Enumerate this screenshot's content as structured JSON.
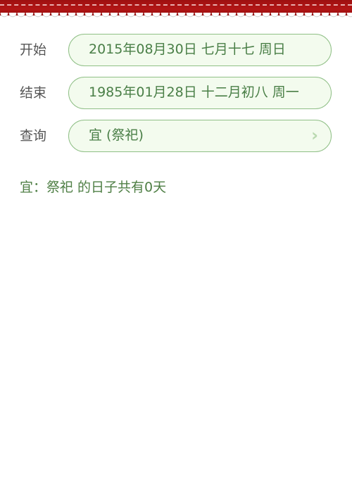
{
  "form": {
    "start": {
      "label": "开始",
      "value": "2015年08月30日 七月十七 周日"
    },
    "end": {
      "label": "结束",
      "value": "1985年01月28日 十二月初八 周一"
    },
    "query": {
      "label": "查询",
      "value": "宜 (祭祀)",
      "icon": "chevron-right-icon"
    }
  },
  "result": {
    "text": "宜：祭祀 的日子共有0天"
  },
  "colors": {
    "accent_text": "#4a7f47",
    "field_border": "#8fbf86",
    "field_bg": "#f3fbee",
    "label_text": "#555555",
    "top_band": "#b31616"
  }
}
